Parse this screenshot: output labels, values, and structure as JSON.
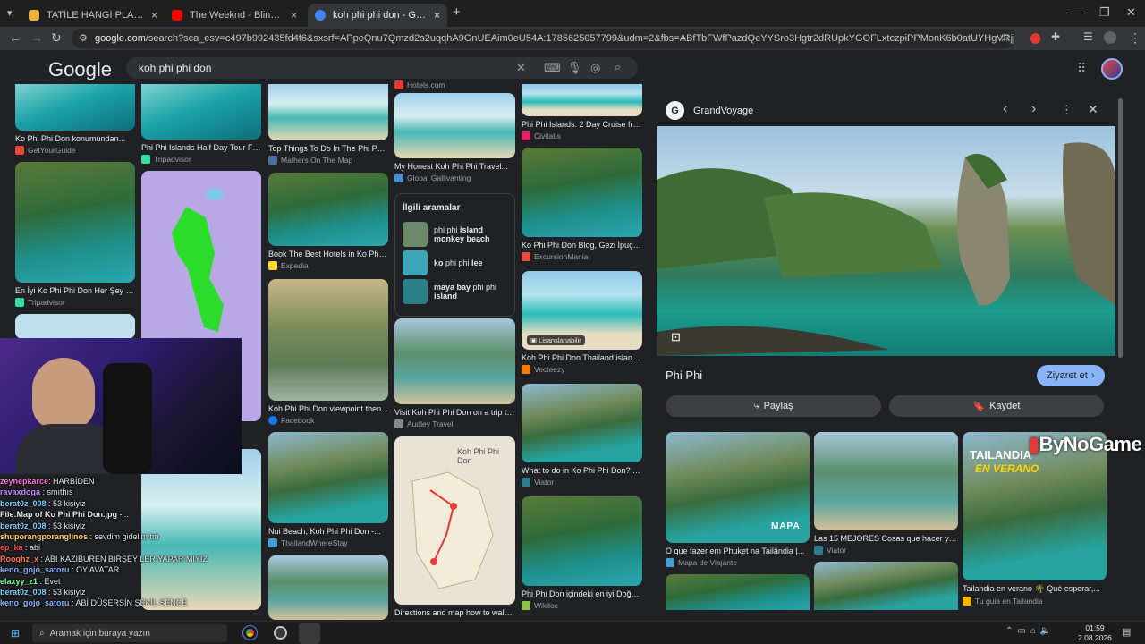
{
  "tabs": [
    {
      "title": "TATİLE HANGİ PLAJA GELİRSİN",
      "close": "×",
      "color": "#e8b13a"
    },
    {
      "title": "The Weeknd - Blinding Lights (",
      "close": "×",
      "color": "#ff0000"
    },
    {
      "title": "koh phi phi don - Google'da Ar",
      "close": "×",
      "color": "#4285f4"
    }
  ],
  "new_tab": "+",
  "window_controls": {
    "minimize": "—",
    "restore": "❐",
    "close": "✕"
  },
  "address": {
    "host": "google.com",
    "path": "/search?sca_esv=c497b992435fd4f6&sxsrf=APpeQnu7Qmzd2s2uqqhA9GnUEAim0eU54A:1785625057799&udm=2&fbs=ABfTbFWfPazdQeYYSro3Hgtr2dRUpkYGOFLxtczpiPPMonK6b0atUYHgVRjjy_HDAjTEFQfjuG68nKYQULJEnKkNg..."
  },
  "google": {
    "logo": "Google",
    "query": "koh phi phi don"
  },
  "grid": {
    "col1": [
      {
        "caption": "Ko Phi Phi Don konumundan...",
        "source": "GetYourGuide",
        "srcColor": "#e94b3c"
      },
      {
        "caption": "En İyi Ko Phi Phi Don Her Şey Da...",
        "source": "Tripadvisor",
        "srcColor": "#34e0a1"
      },
      {
        "caption": "",
        "source": "",
        "srcColor": "#888"
      }
    ],
    "col2": [
      {
        "caption": "Phi Phi Islands Half Day Tour Fro...",
        "source": "Tripadvisor",
        "srcColor": "#34e0a1"
      },
      {
        "caption": "",
        "source": "",
        "srcColor": "#888"
      },
      {
        "caption": "My Honest Koh Phi Phi Travel...",
        "source": "",
        "srcColor": "#888"
      }
    ],
    "col3": [
      {
        "caption": "Top Things To Do In The Phi Phi...",
        "source": "Mathers On The Map",
        "srcColor": "#4a6fa5"
      },
      {
        "caption": "Book The Best Hotels in Ko Phi P...",
        "source": "Expedia",
        "srcColor": "#fdd835"
      },
      {
        "caption": "Koh Phi Phi Don viewpoint then...",
        "source": "Facebook",
        "srcColor": "#1877f2"
      },
      {
        "caption": "Nui Beach, Koh Phi Phi Don -...",
        "source": "ThailandWhereStay",
        "srcColor": "#4a9bd1"
      }
    ],
    "col4_top": {
      "source": "Hotels.com",
      "caption": "My Honest Koh Phi Phi Travel...",
      "source2": "Global Gallivanting",
      "srcColor": "#4a8bd1"
    },
    "related": {
      "title": "İlgili aramalar",
      "items": [
        {
          "plain1": "phi phi ",
          "bold": "island monkey beach",
          "plain2": ""
        },
        {
          "plain1": "",
          "bold": "ko",
          "plain2": " phi phi ",
          "bold2": "lee"
        },
        {
          "plain1": "",
          "bold": "maya bay",
          "plain2": " phi phi ",
          "bold2": "island"
        }
      ]
    },
    "col4": [
      {
        "caption": "Visit Koh Phi Phi Don on a trip to...",
        "source": "Audley Travel",
        "srcColor": "#888"
      },
      {
        "caption": "Directions and map how to walk ...",
        "source": "",
        "srcColor": "#888"
      }
    ],
    "col5": [
      {
        "caption": "Phi Phi Islands: 2 Day Cruise fro...",
        "source": "Civitatis",
        "srcColor": "#e91e63"
      },
      {
        "caption": "Ko Phi Phi Don Blog, Gezi İpuçlar...",
        "source": "ExcursionMania",
        "srcColor": "#e94b3c"
      },
      {
        "caption": "Koh Phi Phi Don Thailand island...",
        "source": "Vecteezy",
        "srcColor": "#f57c00",
        "badge": "Lisanslanabilir"
      },
      {
        "caption": "What to do in Ko Phi Phi Don? Th...",
        "source": "Viator",
        "srcColor": "#2e7d8f"
      },
      {
        "caption": "Phi Phi Don içindeki en iyi Doğa...",
        "source": "Wikiloc",
        "srcColor": "#8bc34a"
      }
    ],
    "map_title": "Koh Phi Phi Don"
  },
  "panel": {
    "site": "GrandVoyage",
    "title": "Phi Phi",
    "visit": "Ziyaret et",
    "share": "Paylaş",
    "save": "Kaydet",
    "related": [
      {
        "caption": "O que fazer em Phuket na Tailândia |...",
        "source": "Mapa de Viajante",
        "srcColor": "#4a9bd1",
        "overlay": "MAPA"
      },
      {
        "caption": "Las 15 MEJORES Cosas que hacer y ver...",
        "source": "Viator",
        "srcColor": "#2e7d8f"
      },
      {
        "caption": "Tailandia en verano 🌴 Qué esperar,...",
        "source": "Tu guia en Tailandia",
        "srcColor": "#f5b400",
        "overlay1": "TAILANDIA",
        "overlay2": "EN VERANO"
      }
    ]
  },
  "watermark": "ByNoGame",
  "chat": [
    {
      "user": "zeynepkarce",
      "msg": ": HARBİDEN",
      "color": "#ff6fd8"
    },
    {
      "user": "ravaxdoga",
      "msg": " : smıthıs",
      "color": "#c98bff"
    },
    {
      "user": "berat0z_008",
      "msg": " : 53 kişiyiz",
      "color": "#7fd3ff"
    },
    {
      "user": "File:Map of Ko Phi Phi Don.jpg",
      "msg": " -...",
      "color": "#e8eaed"
    },
    {
      "user": "berat0z_008",
      "msg": " : 53 kişiyiz",
      "color": "#7fd3ff"
    },
    {
      "user": "shuporangporanglinos",
      "msg": " : sevdim gidelim tm",
      "color": "#ffd166"
    },
    {
      "user": "ep_ka",
      "msg": " : abi",
      "color": "#ff4d4d"
    },
    {
      "user": "Rooghz_x",
      "msg": " : ABİ KAZIBÜREN BİRŞEY LER YAPAR MIYIZ",
      "color": "#ff7a59"
    },
    {
      "user": "keno_gojo_satoru",
      "msg": " : OY AVATAR",
      "color": "#8ab4f8"
    },
    {
      "user": "elaxyy_z1",
      "msg": " : Evet",
      "color": "#7fff9a"
    },
    {
      "user": "berat0z_008",
      "msg": " : 53 kişiyiz",
      "color": "#7fd3ff"
    },
    {
      "user": "keno_gojo_satoru",
      "msg": " : ABİ DÜŞERSİN ŞEKİL SENCE",
      "color": "#8ab4f8"
    }
  ],
  "taskbar": {
    "search_placeholder": "Aramak için buraya yazın",
    "time": "01:59",
    "date": "2.08.2026"
  },
  "colors": {
    "accent": "#8ab4f8",
    "bg": "#202124",
    "visit_bg": "#8ab4f8"
  }
}
